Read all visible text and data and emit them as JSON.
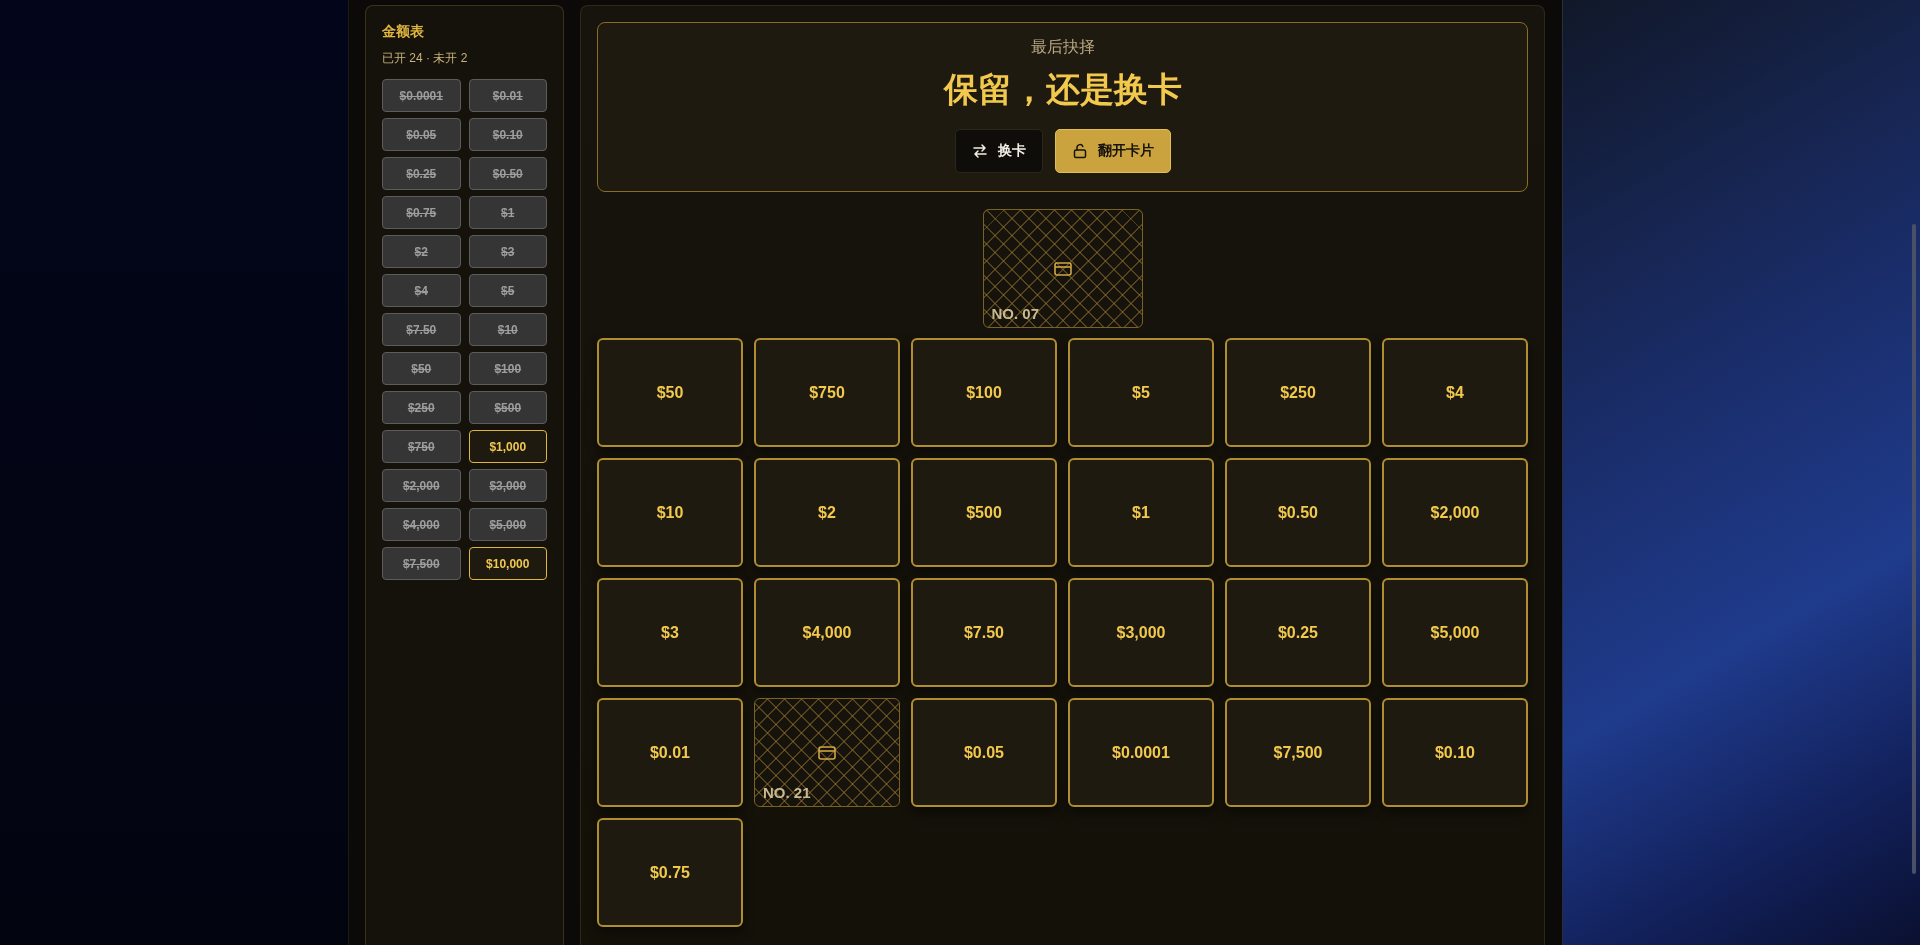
{
  "prize_board": {
    "title": "金额表",
    "summary": "已开 24 · 未开 2",
    "amounts": [
      {
        "value": "$0.0001",
        "opened": true
      },
      {
        "value": "$0.01",
        "opened": true
      },
      {
        "value": "$0.05",
        "opened": true
      },
      {
        "value": "$0.10",
        "opened": true
      },
      {
        "value": "$0.25",
        "opened": true
      },
      {
        "value": "$0.50",
        "opened": true
      },
      {
        "value": "$0.75",
        "opened": true
      },
      {
        "value": "$1",
        "opened": true
      },
      {
        "value": "$2",
        "opened": true
      },
      {
        "value": "$3",
        "opened": true
      },
      {
        "value": "$4",
        "opened": true
      },
      {
        "value": "$5",
        "opened": true
      },
      {
        "value": "$7.50",
        "opened": true
      },
      {
        "value": "$10",
        "opened": true
      },
      {
        "value": "$50",
        "opened": true
      },
      {
        "value": "$100",
        "opened": true
      },
      {
        "value": "$250",
        "opened": true
      },
      {
        "value": "$500",
        "opened": true
      },
      {
        "value": "$750",
        "opened": true
      },
      {
        "value": "$1,000",
        "opened": false
      },
      {
        "value": "$2,000",
        "opened": true
      },
      {
        "value": "$3,000",
        "opened": true
      },
      {
        "value": "$4,000",
        "opened": true
      },
      {
        "value": "$5,000",
        "opened": true
      },
      {
        "value": "$7,500",
        "opened": true
      },
      {
        "value": "$10,000",
        "opened": false
      }
    ]
  },
  "decision": {
    "subtitle": "最后抉择",
    "title": "保留，还是换卡",
    "buttons": [
      {
        "label": "换卡",
        "kind": "swap"
      },
      {
        "label": "翻开卡片",
        "kind": "reveal"
      }
    ]
  },
  "held_card": {
    "kind": "hidden",
    "number": "NO. 07"
  },
  "cards": [
    {
      "kind": "value",
      "value": "$50"
    },
    {
      "kind": "value",
      "value": "$750"
    },
    {
      "kind": "value",
      "value": "$100"
    },
    {
      "kind": "value",
      "value": "$5"
    },
    {
      "kind": "value",
      "value": "$250"
    },
    {
      "kind": "value",
      "value": "$4"
    },
    {
      "kind": "value",
      "value": "$10"
    },
    {
      "kind": "value",
      "value": "$2"
    },
    {
      "kind": "value",
      "value": "$500"
    },
    {
      "kind": "value",
      "value": "$1"
    },
    {
      "kind": "value",
      "value": "$0.50"
    },
    {
      "kind": "value",
      "value": "$2,000"
    },
    {
      "kind": "value",
      "value": "$3"
    },
    {
      "kind": "value",
      "value": "$4,000"
    },
    {
      "kind": "value",
      "value": "$7.50"
    },
    {
      "kind": "value",
      "value": "$3,000"
    },
    {
      "kind": "value",
      "value": "$0.25"
    },
    {
      "kind": "value",
      "value": "$5,000"
    },
    {
      "kind": "value",
      "value": "$0.01"
    },
    {
      "kind": "hidden",
      "number": "NO. 21"
    },
    {
      "kind": "value",
      "value": "$0.05"
    },
    {
      "kind": "value",
      "value": "$0.0001"
    },
    {
      "kind": "value",
      "value": "$7,500"
    },
    {
      "kind": "value",
      "value": "$0.10"
    },
    {
      "kind": "value",
      "value": "$0.75"
    }
  ]
}
